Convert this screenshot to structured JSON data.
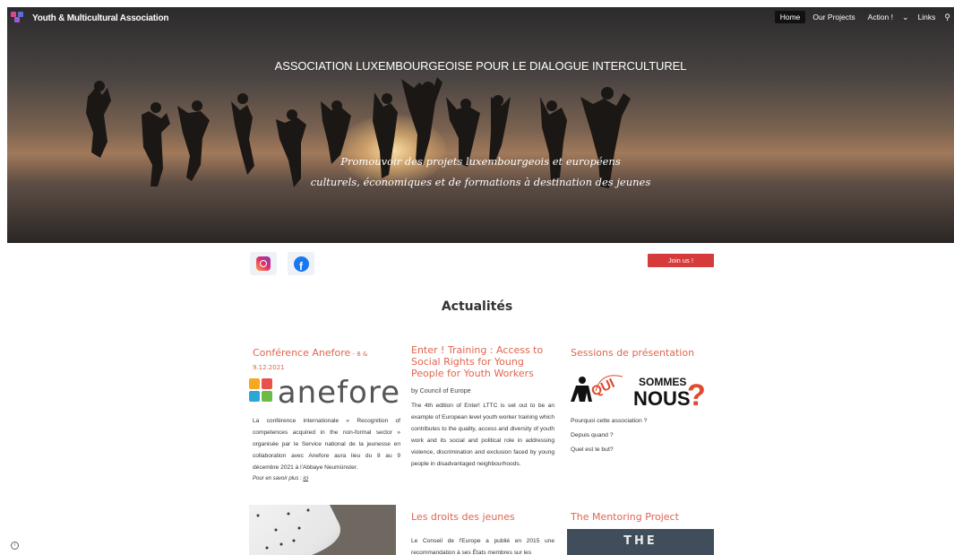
{
  "site": {
    "brand": "Youth & Multicultural Association",
    "nav": [
      {
        "label": "Home",
        "active": true
      },
      {
        "label": "Our Projects",
        "active": false
      },
      {
        "label": "Action !",
        "active": false
      },
      {
        "label": "Links",
        "active": false
      }
    ],
    "nav_icons": [
      "chevron-down-icon",
      "search-icon"
    ]
  },
  "hero": {
    "title": "ASSOCIATION LUXEMBOURGEOISE POUR LE DIALOGUE INTERCULTUREL",
    "subtitle_line1": "Promouvoir des projets luxembourgeois et européens",
    "subtitle_line2": "culturels, économiques et de formations à destination des jeunes"
  },
  "social": {
    "icons": [
      "instagram-icon",
      "facebook-icon"
    ],
    "join_label": "Join us !"
  },
  "news": {
    "heading": "Actualités",
    "cards": [
      {
        "title": "Conférence Anefore",
        "date": " - 8 & 9.12.2021",
        "logo_text": "anefore",
        "body": "La conférence internationale « Recognition of competences acquired in the non-formal sector » organisée par le Service national de la jeunesse en collaboration avec Anefore aura lieu du 8 au 9 décembre 2021 à l'Abbaye Neumünster.",
        "more_label": "Pour en savoir plus : ",
        "more_link": "ici"
      },
      {
        "title": "Enter ! Training : Access to Social Rights for Young People for Youth Workers",
        "by": "by Council of Europe",
        "body": "The 4th edition of Enter! LTTC is set out to be an example of European level youth worker training which contributes to the quality, access and diversity of youth work and its social and political role in addressing violence, discrimination and exclusion faced by young people in disadvantaged neighbourhoods."
      },
      {
        "title": "Sessions de présentation",
        "logo_text_1": "QUI",
        "logo_text_2": "SOMMES",
        "logo_text_3": "NOUS",
        "logo_text_4": "?",
        "questions": [
          "Pourquoi cette association ?",
          "Depuis quand ?",
          "Quel est le but?"
        ]
      },
      {
        "title": "Les droits des jeunes",
        "body": "Le Conseil de l'Europe a publié en 2015 une recommandation à ses États membres sur les"
      },
      {
        "title": "The Mentoring Project",
        "image_text": "THE"
      }
    ]
  },
  "colors": {
    "accent": "#e0654f",
    "join": "#d63b3b",
    "nav_active": "#111111"
  }
}
